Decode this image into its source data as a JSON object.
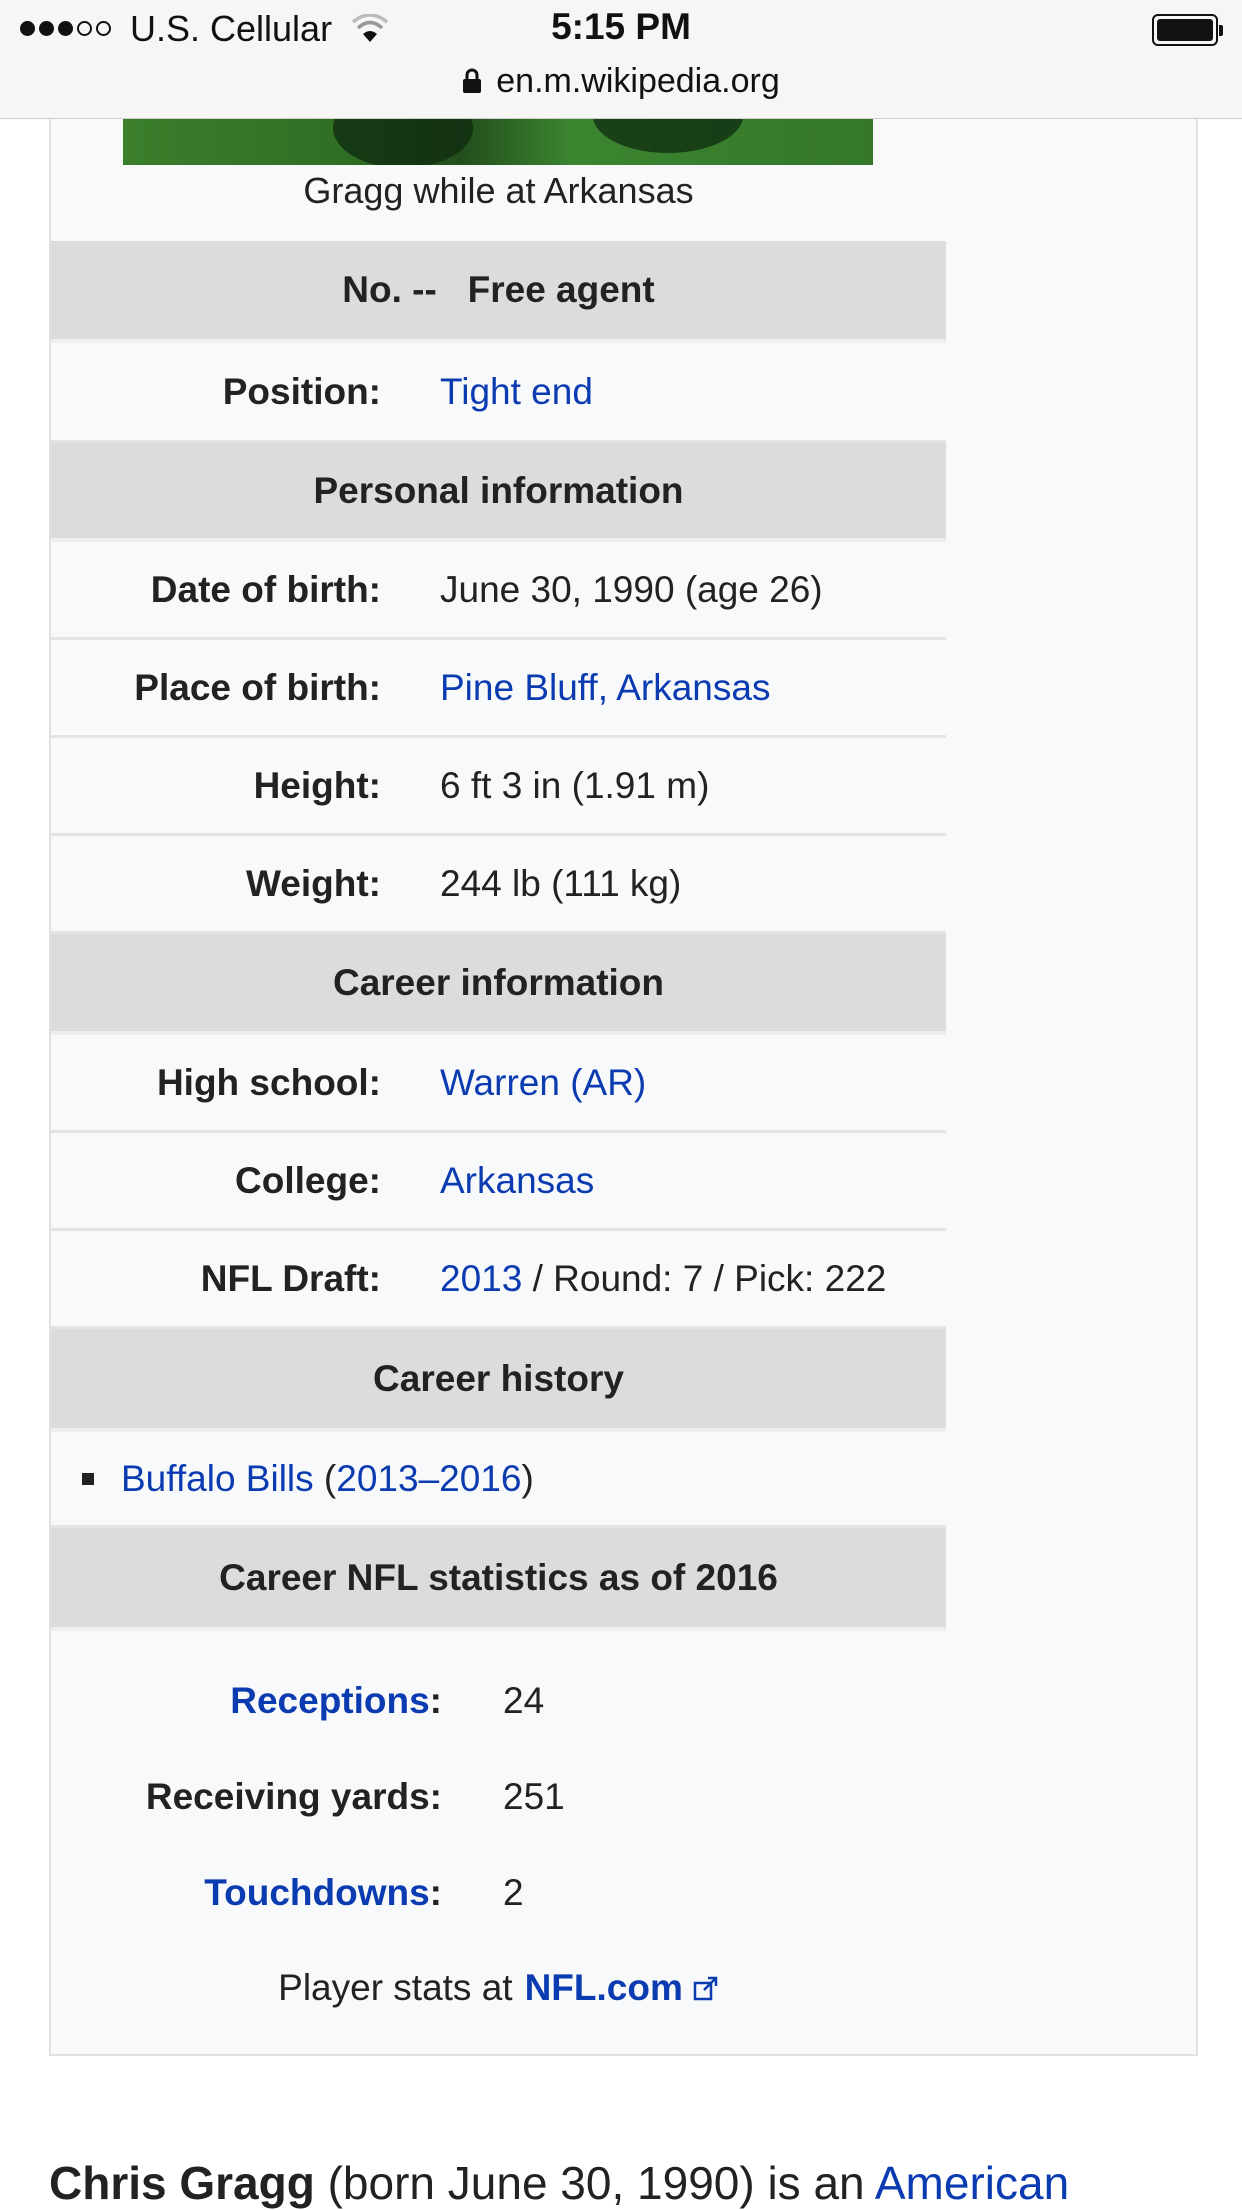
{
  "status_bar": {
    "carrier": "U.S. Cellular",
    "time": "5:15 PM",
    "signal_bars_filled": 3,
    "signal_bars_total": 5
  },
  "browser": {
    "url": "en.m.wikipedia.org"
  },
  "infobox": {
    "caption": "Gragg while at Arkansas",
    "number_header": "No. --   Free agent",
    "position": {
      "label": "Position:",
      "value": "Tight end"
    },
    "personal_header": "Personal information",
    "date_of_birth": {
      "label": "Date of birth:",
      "value": "June 30, 1990 (age 26)"
    },
    "place_of_birth": {
      "label": "Place of birth:",
      "value": "Pine Bluff, Arkansas"
    },
    "height": {
      "label": "Height:",
      "value": "6 ft 3 in (1.91 m)"
    },
    "weight": {
      "label": "Weight:",
      "value": "244 lb (111 kg)"
    },
    "career_header": "Career information",
    "high_school": {
      "label": "High school:",
      "value": "Warren (AR)"
    },
    "college": {
      "label": "College:",
      "value": "Arkansas"
    },
    "nfl_draft": {
      "label": "NFL Draft:",
      "year": "2013",
      "rest": " / Round: 7 / Pick: 222"
    },
    "history_header": "Career history",
    "history": [
      {
        "team": "Buffalo Bills",
        "open": " (",
        "years": "2013–2016",
        "close": ")"
      }
    ],
    "stats_header": "Career NFL statistics as of 2016",
    "stats": [
      {
        "label": "Receptions",
        "colon": ":",
        "value": "24",
        "link": true
      },
      {
        "label": "Receiving yards:",
        "value": "251",
        "link": false
      },
      {
        "label": "Touchdowns",
        "colon": ":",
        "value": "2",
        "link": true
      }
    ],
    "player_stats_text": "Player stats at",
    "player_stats_link": "NFL.com"
  },
  "article": {
    "name": "Chris Gragg",
    "intro": " (born June 30, 1990) is an ",
    "link": "American"
  },
  "colors": {
    "link": "#0b3bb0",
    "header_bg": "#dcdcdc",
    "infobox_bg": "#f8f9fa"
  },
  "icons": [
    "wifi-icon",
    "lock-icon",
    "battery-icon",
    "external-link-icon"
  ]
}
